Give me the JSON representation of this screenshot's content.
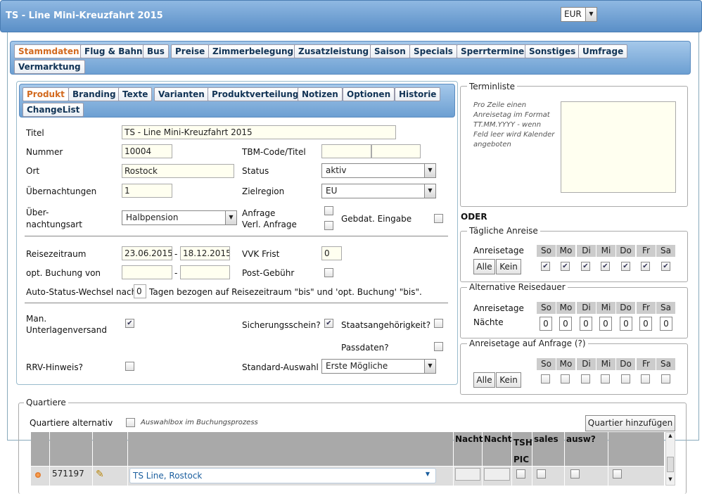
{
  "app": {
    "title": "TS - Line Mini-Kreuzfahrt 2015",
    "currency": "EUR"
  },
  "main_tabs": [
    "Stammdaten",
    "Flug & Bahn",
    "Bus",
    "Preise",
    "Zimmerbelegung",
    "Zusatzleistung",
    "Saison",
    "Specials",
    "Sperrtermine",
    "Sonstiges",
    "Umfrage",
    "Vermarktung"
  ],
  "sub_tabs": [
    "Produkt",
    "Branding",
    "Texte",
    "Varianten",
    "Produktverteilung",
    "Notizen",
    "Optionen",
    "Historie",
    "ChangeList"
  ],
  "form": {
    "titel_label": "Titel",
    "titel_value": "TS - Line  Mini-Kreuzfahrt 2015",
    "nummer_label": "Nummer",
    "nummer_value": "10004",
    "tbm_label": "TBM-Code/Titel",
    "ort_label": "Ort",
    "ort_value": "Rostock",
    "status_label": "Status",
    "status_value": "aktiv",
    "uebernachtungen_label": "Übernachtungen",
    "uebernachtungen_value": "1",
    "zielregion_label": "Zielregion",
    "zielregion_value": "EU",
    "art_label1": "Über-",
    "art_label2": "nachtungsart",
    "art_value": "Halbpension",
    "anfrage_label": "Anfrage",
    "verl_anfrage_label": "Verl. Anfrage",
    "gebdat_label": "Gebdat. Eingabe",
    "reisezeitraum_label": "Reisezeitraum",
    "reise_von": "23.06.2015",
    "reise_bis": "18.12.2015",
    "dash": "-",
    "vvk_label": "VVK Frist",
    "vvk_value": "0",
    "optbuchung_label": "opt. Buchung von",
    "postgebuehr_label": "Post-Gebühr",
    "auto_label1": "Auto-Status-Wechsel nach",
    "auto_value": "0",
    "auto_label2": "Tagen bezogen auf Reisezeitraum \"bis\" und 'opt. Buchung' \"bis\".",
    "man_label1": "Man.",
    "man_label2": "Unterlagenversand",
    "sicherung_label": "Sicherungsschein?",
    "staats_label": "Staatsangehörigkeit?",
    "pass_label": "Passdaten?",
    "rrv_label": "RRV-Hinweis?",
    "standard_label": "Standard-Auswahl",
    "standard_value": "Erste Mögliche"
  },
  "termin": {
    "legend": "Terminliste",
    "hint": "Pro Zeile einen Anreisetag im Format TT.MM.YYYY - wenn Feld leer wird Kalender angeboten",
    "oder": "ODER"
  },
  "taeglich": {
    "legend": "Tägliche Anreise",
    "label": "Anreisetage",
    "alle": "Alle",
    "kein": "Kein",
    "days": [
      "So",
      "Mo",
      "Di",
      "Mi",
      "Do",
      "Fr",
      "Sa"
    ]
  },
  "alternativ": {
    "legend": "Alternative Reisedauer",
    "label": "Anreisetage",
    "naechte": "Nächte",
    "values": [
      "0",
      "0",
      "0",
      "0",
      "0",
      "0",
      "0"
    ]
  },
  "anfrage": {
    "legend": "Anreisetage auf Anfrage (?)",
    "alle": "Alle",
    "kein": "Kein"
  },
  "quartiere": {
    "legend": "Quartiere",
    "alt_label": "Quartiere alternativ",
    "auswahl_hint": "Auswahlbox im Buchungsprozess",
    "add_button": "Quartier hinzufügen",
    "headers": [
      "Nacht",
      "Nacht",
      "TSH PIC",
      "sales",
      "ausw?"
    ],
    "row": {
      "id": "571197",
      "name": "TS Line, Rostock"
    }
  }
}
